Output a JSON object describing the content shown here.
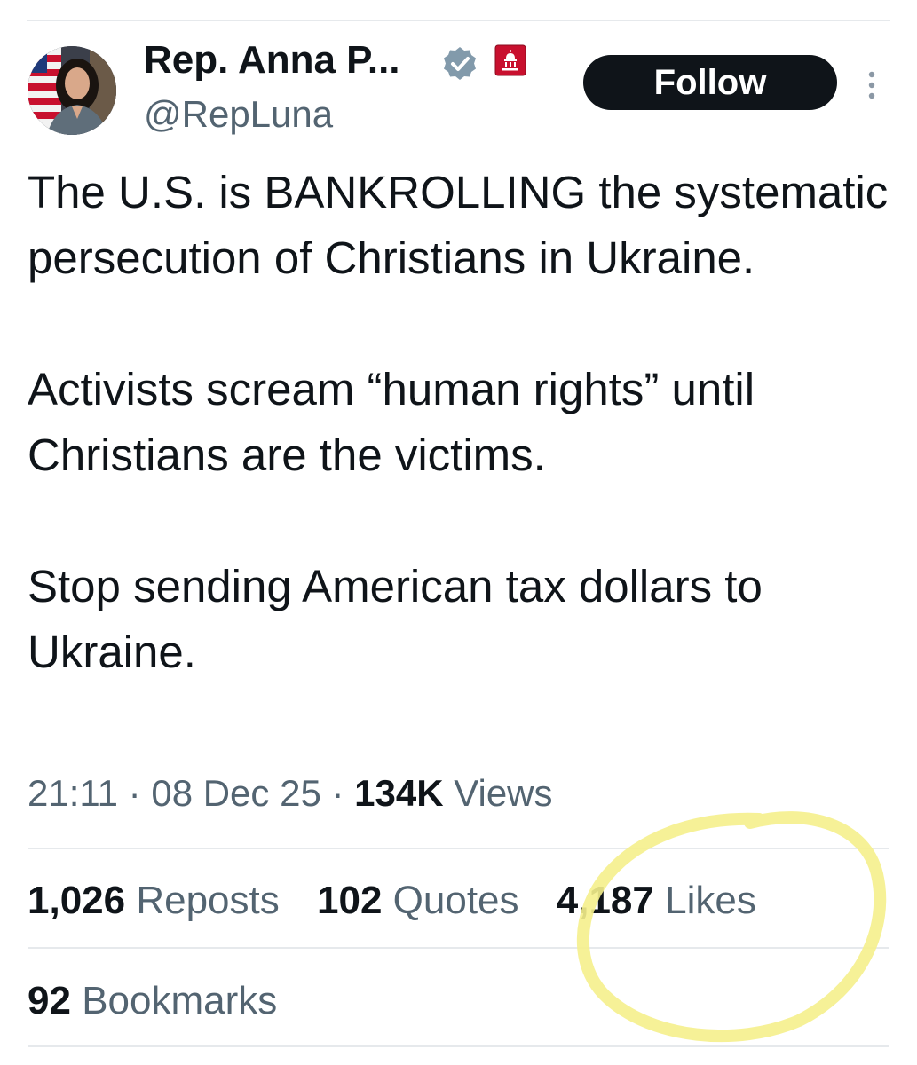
{
  "author": {
    "display_name": "Rep. Anna P...",
    "handle": "@RepLuna",
    "verified_icon": "verified-badge-icon",
    "affiliation_icon": "us-capitol-badge-icon"
  },
  "follow_label": "Follow",
  "more_icon": "more-vertical-icon",
  "tweet": {
    "paragraphs": [
      "The U.S. is BANKROLLING the systematic persecution of Christians in Ukraine.",
      "Activists scream “human rights” until Christians are the victims.",
      "Stop sending American tax dollars to Ukraine."
    ]
  },
  "meta": {
    "time": "21:11",
    "separator": "·",
    "date": "08 Dec 25",
    "views_count": "134K",
    "views_label": "Views"
  },
  "stats": {
    "reposts_count": "1,026",
    "reposts_label": "Reposts",
    "quotes_count": "102",
    "quotes_label": "Quotes",
    "likes_count": "4,187",
    "likes_label": "Likes",
    "bookmarks_count": "92",
    "bookmarks_label": "Bookmarks"
  },
  "colors": {
    "text_primary": "#0f1419",
    "text_secondary": "#536471",
    "verified_badge": "#829aab",
    "gov_badge": "#c8102e",
    "highlight": "#f5f08c",
    "divider": "#e6e9ec"
  }
}
